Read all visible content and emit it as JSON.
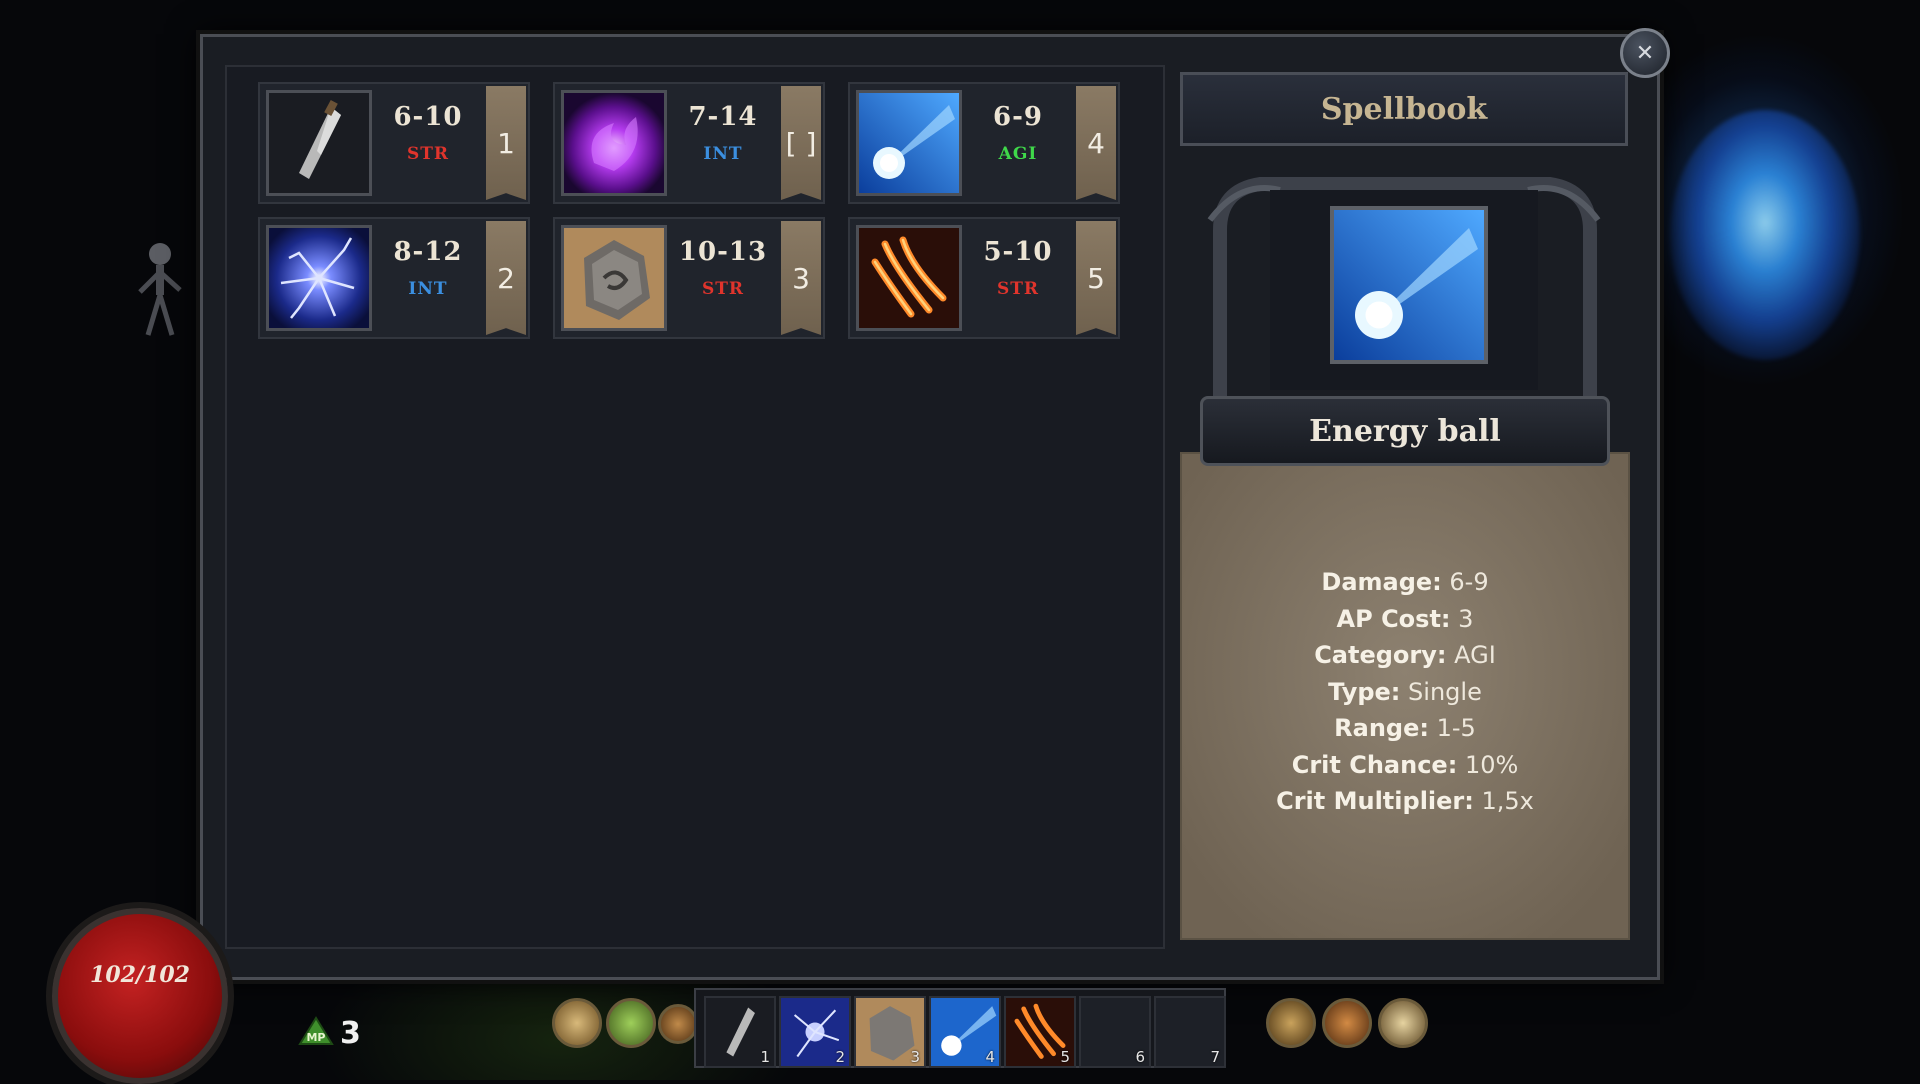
{
  "hud": {
    "hp_text": "102/102",
    "mp_label": "MP",
    "mp_value": "3",
    "hp_color": "#b91c1c"
  },
  "spellbook_panel": {
    "close_label": "✕",
    "cards": [
      {
        "icon": "sword-icon",
        "damage": "6-10",
        "category": "STR",
        "slot": "1"
      },
      {
        "icon": "purple-fireball-icon",
        "damage": "7-14",
        "category": "INT",
        "slot": "[ ]"
      },
      {
        "icon": "energy-ball-icon",
        "damage": "6-9",
        "category": "AGI",
        "slot": "4"
      },
      {
        "icon": "lightning-icon",
        "damage": "8-12",
        "category": "INT",
        "slot": "2"
      },
      {
        "icon": "rock-icon",
        "damage": "10-13",
        "category": "STR",
        "slot": "3"
      },
      {
        "icon": "claw-icon",
        "damage": "5-10",
        "category": "STR",
        "slot": "5"
      }
    ],
    "category_colors": {
      "STR": "#e0342c",
      "INT": "#3b8fe0",
      "AGI": "#3fd84a"
    }
  },
  "spellbook": {
    "title": "Spellbook",
    "selected_spell": "Energy ball",
    "stats": [
      {
        "label": "Damage:",
        "value": "6-9"
      },
      {
        "label": "AP Cost:",
        "value": "3"
      },
      {
        "label": "Category:",
        "value": "AGI"
      },
      {
        "label": "Type:",
        "value": "Single"
      },
      {
        "label": "Range:",
        "value": "1-5"
      },
      {
        "label": "Crit Chance:",
        "value": "10%"
      },
      {
        "label": "Crit Multiplier:",
        "value": "1,5x"
      }
    ]
  },
  "hotbar": {
    "slots": [
      {
        "num": "1",
        "icon": "sword-icon"
      },
      {
        "num": "2",
        "icon": "lightning-icon"
      },
      {
        "num": "3",
        "icon": "rock-icon"
      },
      {
        "num": "4",
        "icon": "energy-ball-icon"
      },
      {
        "num": "5",
        "icon": "claw-icon"
      },
      {
        "num": "6",
        "icon": ""
      },
      {
        "num": "7",
        "icon": ""
      }
    ]
  },
  "menu_buttons": [
    "quest-scroll-icon",
    "skill-tree-icon",
    "ability-icon",
    "character-icon",
    "inventory-icon",
    "spellbook-icon"
  ]
}
